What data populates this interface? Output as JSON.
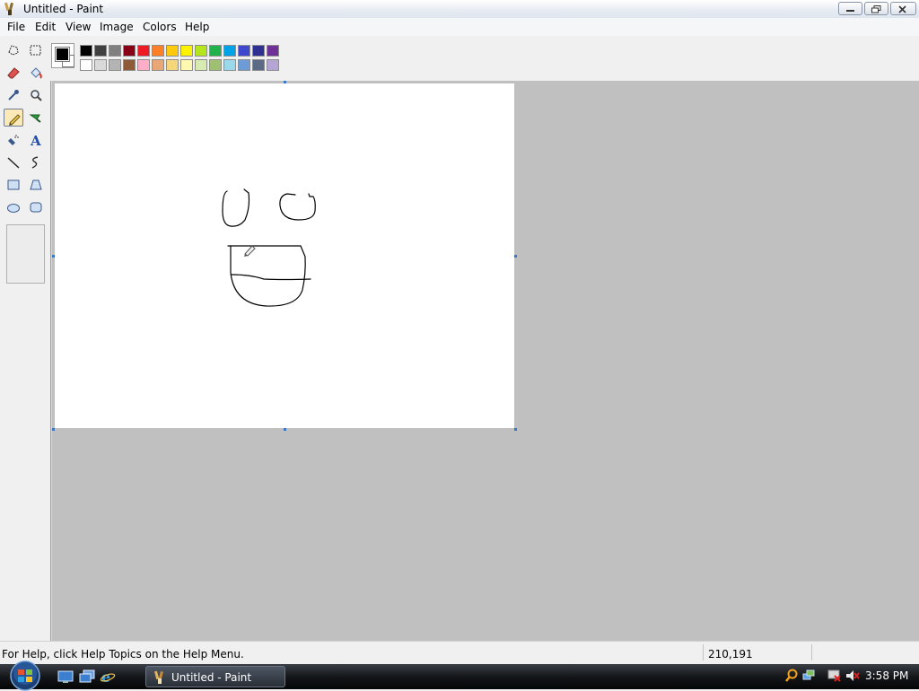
{
  "window": {
    "title": "Untitled - Paint"
  },
  "menu": [
    "File",
    "Edit",
    "View",
    "Image",
    "Colors",
    "Help"
  ],
  "tools": [
    "free-form-select",
    "select",
    "eraser",
    "fill-with-color",
    "pick-color",
    "magnifier",
    "pencil",
    "brush",
    "airbrush",
    "text",
    "line",
    "curve",
    "rectangle",
    "polygon",
    "ellipse",
    "rounded-rectangle"
  ],
  "active_tool": "pencil",
  "palette": {
    "foreground": "#000000",
    "background": "#ffffff",
    "row1": [
      "#000000",
      "#404040",
      "#7f7f7f",
      "#880015",
      "#ed1c24",
      "#ff7f27",
      "#ffc90e",
      "#fff200",
      "#b5e61d",
      "#22b14c",
      "#00a2e8",
      "#3f48cc",
      "#2e3192",
      "#6f3198"
    ],
    "row2": [
      "#ffffff",
      "#d9d9d9",
      "#b4b4b4",
      "#8f5a38",
      "#ffaec9",
      "#e9a775",
      "#f5d67a",
      "#fff8b0",
      "#d7eab0",
      "#9fbf73",
      "#99d9ea",
      "#6d9bd6",
      "#5c6b85",
      "#b5a5d5"
    ]
  },
  "status": {
    "help": "For Help, click Help Topics on the Help Menu.",
    "coords": "210,191"
  },
  "taskbar": {
    "task": "Untitled - Paint",
    "clock": "3:58 PM"
  }
}
